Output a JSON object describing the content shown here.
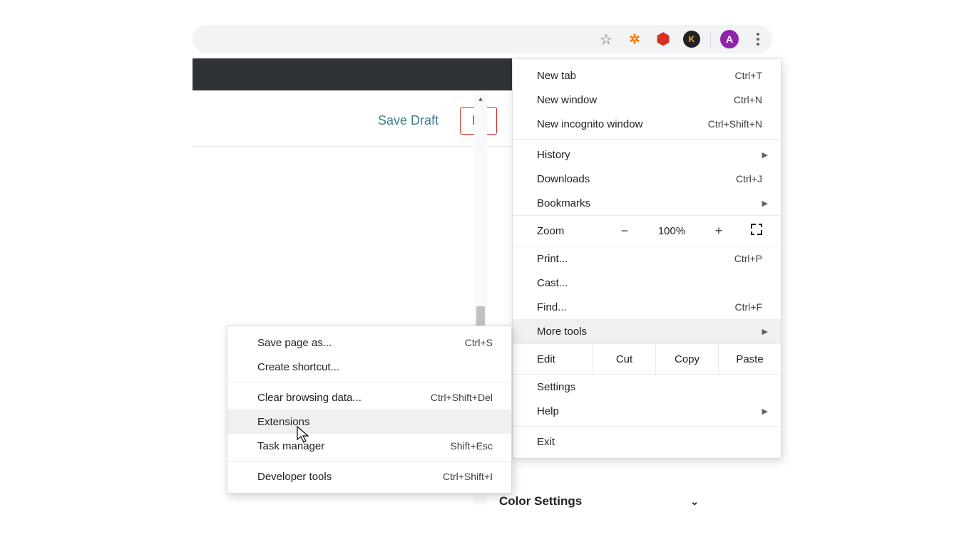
{
  "toolbar": {
    "star_tooltip": "Bookmark",
    "extensions": [
      {
        "name": "so-extension",
        "bg": "#ffffff",
        "fg": "#f57c00",
        "text": "✿"
      },
      {
        "name": "ublock-extension",
        "bg": "#ffffff",
        "fg": "#d93025",
        "text": "⬢"
      },
      {
        "name": "k-extension",
        "bg": "#202124",
        "fg": "#ffb300",
        "text": "K"
      }
    ],
    "profile": {
      "letter": "A",
      "bg": "#8e24aa"
    }
  },
  "page": {
    "save_draft": "Save Draft",
    "preview_partial": "Pr",
    "color_settings": "Color Settings"
  },
  "menu": {
    "new_tab": {
      "label": "New tab",
      "shortcut": "Ctrl+T"
    },
    "new_window": {
      "label": "New window",
      "shortcut": "Ctrl+N"
    },
    "incognito": {
      "label": "New incognito window",
      "shortcut": "Ctrl+Shift+N"
    },
    "history": {
      "label": "History"
    },
    "downloads": {
      "label": "Downloads",
      "shortcut": "Ctrl+J"
    },
    "bookmarks": {
      "label": "Bookmarks"
    },
    "zoom": {
      "label": "Zoom",
      "value": "100%",
      "minus": "−",
      "plus": "+"
    },
    "print": {
      "label": "Print...",
      "shortcut": "Ctrl+P"
    },
    "cast": {
      "label": "Cast..."
    },
    "find": {
      "label": "Find...",
      "shortcut": "Ctrl+F"
    },
    "more_tools": {
      "label": "More tools"
    },
    "edit": {
      "label": "Edit",
      "cut": "Cut",
      "copy": "Copy",
      "paste": "Paste"
    },
    "settings": {
      "label": "Settings"
    },
    "help": {
      "label": "Help"
    },
    "exit": {
      "label": "Exit"
    }
  },
  "submenu": {
    "save_page": {
      "label": "Save page as...",
      "shortcut": "Ctrl+S"
    },
    "create_shortcut": {
      "label": "Create shortcut..."
    },
    "clear_data": {
      "label": "Clear browsing data...",
      "shortcut": "Ctrl+Shift+Del"
    },
    "extensions": {
      "label": "Extensions"
    },
    "task_manager": {
      "label": "Task manager",
      "shortcut": "Shift+Esc"
    },
    "dev_tools": {
      "label": "Developer tools",
      "shortcut": "Ctrl+Shift+I"
    }
  }
}
